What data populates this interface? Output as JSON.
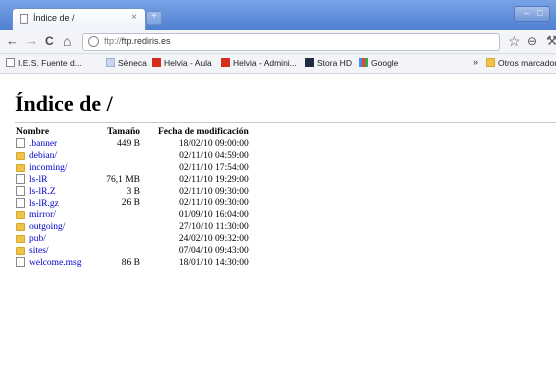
{
  "browser": {
    "tab_title": "Índice de /",
    "tab_close": "×",
    "new_tab": "+",
    "win_minimize": "–",
    "win_maximize": "□",
    "url_scheme": "ftp://",
    "url_host": "ftp.rediris.es",
    "nav": {
      "back": "←",
      "forward": "→",
      "reload": "C",
      "home": "⌂"
    },
    "star": "☆",
    "page_menu": "⊖",
    "wrench": "⚒"
  },
  "bookmarks": {
    "items": [
      {
        "label": "I.E.S. Fuente d...",
        "icon": "page-icon",
        "color": "#ffffff"
      },
      {
        "label": "Séneca",
        "icon": "seneca-icon",
        "color": "#c9d6ef"
      },
      {
        "label": "Helvia - Aula",
        "icon": "helvia-icon",
        "color": "#d72c1b"
      },
      {
        "label": "Helvia - Admini...",
        "icon": "helvia-icon",
        "color": "#d72c1b"
      },
      {
        "label": "Stora HD",
        "icon": "stora-icon",
        "color": "#1d2b44"
      },
      {
        "label": "Google",
        "icon": "google-icon",
        "color": "#4a8df2"
      }
    ],
    "overflow": "»",
    "other": "Otros marcadores"
  },
  "page": {
    "heading": "Índice de /",
    "columns": {
      "name": "Nombre",
      "size": "Tamaño",
      "date": "Fecha de modificación"
    },
    "rows": [
      {
        "type": "file",
        "name": ".banner",
        "size": "449 B",
        "date": "18/02/10 09:00:00"
      },
      {
        "type": "dir",
        "name": "debian/",
        "size": "",
        "date": "02/11/10 04:59:00"
      },
      {
        "type": "dir",
        "name": "incoming/",
        "size": "",
        "date": "02/11/10 17:54:00"
      },
      {
        "type": "file",
        "name": "ls-lR",
        "size": "76,1 MB",
        "date": "02/11/10 19:29:00"
      },
      {
        "type": "file",
        "name": "ls-lR.Z",
        "size": "3 B",
        "date": "02/11/10 09:30:00"
      },
      {
        "type": "file",
        "name": "ls-lR.gz",
        "size": "26 B",
        "date": "02/11/10 09:30:00"
      },
      {
        "type": "dir",
        "name": "mirror/",
        "size": "",
        "date": "01/09/10 16:04:00"
      },
      {
        "type": "dir",
        "name": "outgoing/",
        "size": "",
        "date": "27/10/10 11:30:00"
      },
      {
        "type": "dir",
        "name": "pub/",
        "size": "",
        "date": "24/02/10 09:32:00"
      },
      {
        "type": "dir",
        "name": "sites/",
        "size": "",
        "date": "07/04/10 09:43:00"
      },
      {
        "type": "file",
        "name": "welcome.msg",
        "size": "86 B",
        "date": "18/01/10 14:30:00"
      }
    ]
  }
}
